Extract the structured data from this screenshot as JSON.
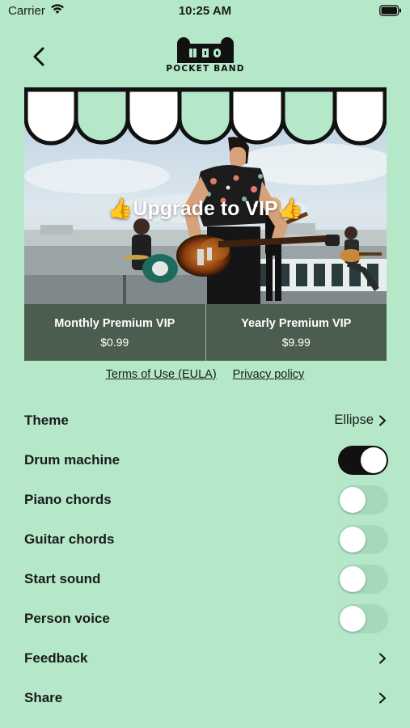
{
  "status_bar": {
    "carrier": "Carrier",
    "time": "10:25 AM"
  },
  "logo": {
    "brand": "POCKET BAND",
    "badge": "U I O"
  },
  "hero": {
    "title": "👍Upgrade to VIP👍"
  },
  "plans": [
    {
      "name": "Monthly Premium VIP",
      "price": "$0.99"
    },
    {
      "name": "Yearly Premium VIP",
      "price": "$9.99"
    }
  ],
  "links": {
    "terms": "Terms of Use (EULA)",
    "privacy": "Privacy policy"
  },
  "settings": {
    "theme": {
      "label": "Theme",
      "value": "Ellipse"
    },
    "drum_machine": {
      "label": "Drum machine",
      "on": true
    },
    "piano_chords": {
      "label": "Piano chords",
      "on": false
    },
    "guitar_chords": {
      "label": "Guitar chords",
      "on": false
    },
    "start_sound": {
      "label": "Start sound",
      "on": false
    },
    "person_voice": {
      "label": "Person voice",
      "on": false
    },
    "feedback": {
      "label": "Feedback"
    },
    "share": {
      "label": "Share"
    }
  },
  "colors": {
    "background": "#b4e8c9",
    "plan_bar": "#4b5d4f",
    "toggle_on": "#111111",
    "toggle_off": "#a5d9bb"
  }
}
